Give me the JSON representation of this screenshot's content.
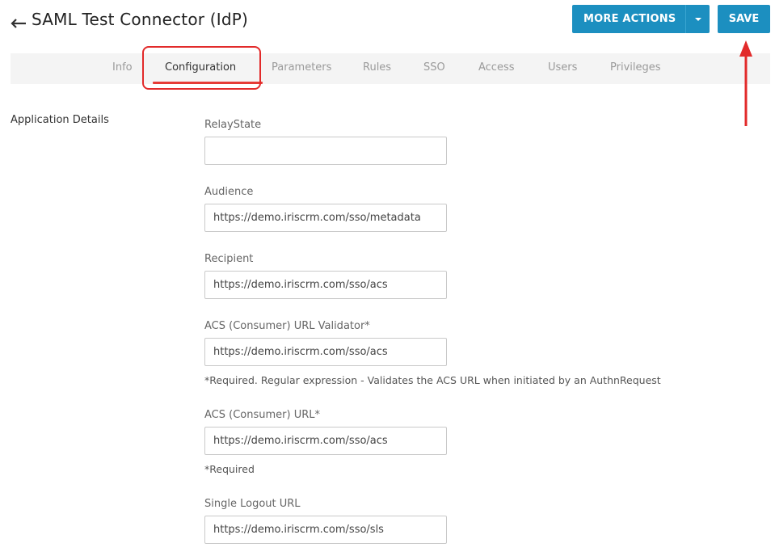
{
  "header": {
    "title": "SAML Test Connector (IdP)",
    "back_icon": "arrow-left-icon",
    "more_actions_label": "MORE ACTIONS",
    "save_label": "SAVE"
  },
  "tabs": [
    {
      "label": "Info",
      "active": false
    },
    {
      "label": "Configuration",
      "active": true
    },
    {
      "label": "Parameters",
      "active": false
    },
    {
      "label": "Rules",
      "active": false
    },
    {
      "label": "SSO",
      "active": false
    },
    {
      "label": "Access",
      "active": false
    },
    {
      "label": "Users",
      "active": false
    },
    {
      "label": "Privileges",
      "active": false
    }
  ],
  "section": {
    "title": "Application Details"
  },
  "fields": [
    {
      "label": "RelayState",
      "value": ""
    },
    {
      "label": "Audience",
      "value": "https://demo.iriscrm.com/sso/metadata"
    },
    {
      "label": "Recipient",
      "value": "https://demo.iriscrm.com/sso/acs"
    },
    {
      "label": "ACS (Consumer) URL Validator*",
      "value": "https://demo.iriscrm.com/sso/acs",
      "hint": "*Required. Regular expression - Validates the ACS URL when initiated by an AuthnRequest"
    },
    {
      "label": "ACS (Consumer) URL*",
      "value": "https://demo.iriscrm.com/sso/acs",
      "hint": "*Required"
    },
    {
      "label": "Single Logout URL",
      "value": "https://demo.iriscrm.com/sso/sls"
    }
  ],
  "colors": {
    "primary_button": "#1c8fc0",
    "active_tab_underline": "#e63b36",
    "annotation": "#e22a2a"
  }
}
